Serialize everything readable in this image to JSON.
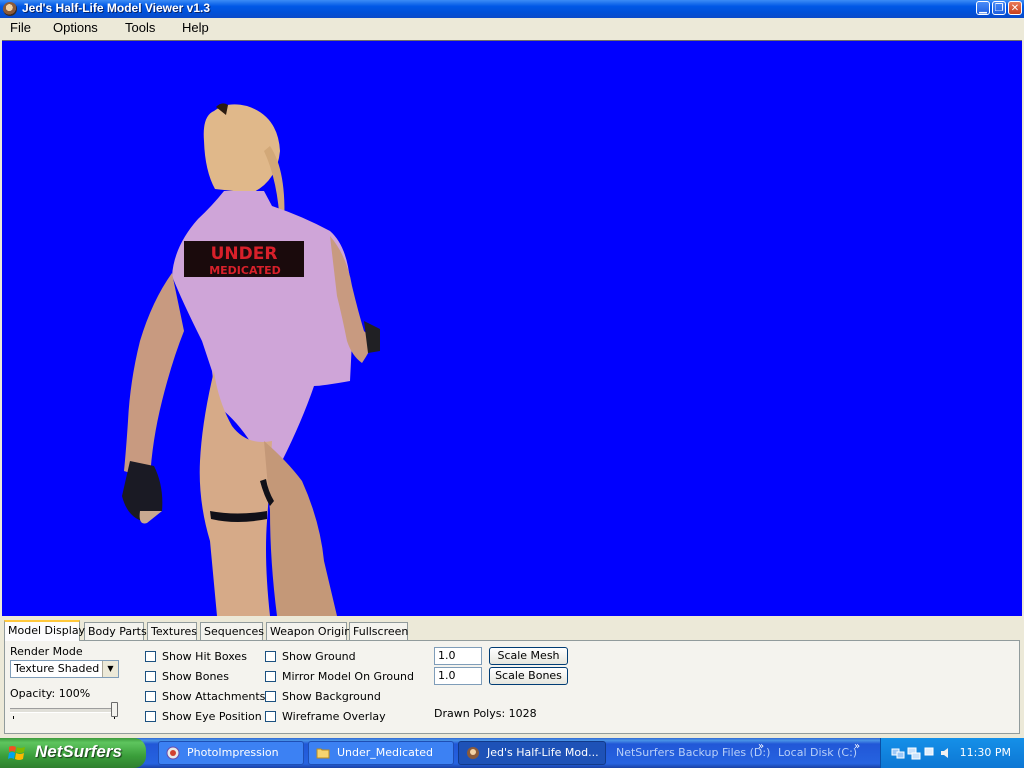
{
  "window": {
    "title": "Jed's Half-Life Model Viewer v1.3",
    "controls": [
      "minimize",
      "maximize",
      "close"
    ]
  },
  "menu": [
    "File",
    "Options",
    "Tools",
    "Help"
  ],
  "viewport": {
    "background": "#0000FF",
    "model_text_line1": "UNDER",
    "model_text_line2": "MEDICATED"
  },
  "tabs": [
    "Model Display",
    "Body Parts",
    "Textures",
    "Sequences",
    "Weapon Origin",
    "Fullscreen"
  ],
  "panel": {
    "render_mode_label": "Render Mode",
    "render_mode_value": "Texture Shaded",
    "opacity_label": "Opacity: 100%",
    "opacity_value": 1.0,
    "checkboxes_col1": [
      "Show Hit Boxes",
      "Show Bones",
      "Show Attachments",
      "Show Eye Position"
    ],
    "checkboxes_col2": [
      "Show Ground",
      "Mirror Model On Ground",
      "Show Background",
      "Wireframe Overlay"
    ],
    "scale_mesh_value": "1.0",
    "scale_bones_value": "1.0",
    "scale_mesh_label": "Scale Mesh",
    "scale_bones_label": "Scale Bones",
    "drawn_polys": "Drawn Polys: 1028"
  },
  "taskbar": {
    "start_label": "NetSurfers",
    "tasks": [
      "PhotoImpression",
      "Under_Medicated",
      "Jed's Half-Life Mod..."
    ],
    "links": [
      "NetSurfers Backup Files (D:)",
      "Local Disk (C:)"
    ],
    "chevrons": [
      "»",
      "»"
    ],
    "clock": "11:30 PM"
  },
  "colors": {
    "titlebar": "#0054E3",
    "viewport": "#0000FF",
    "taskbar": "#245EDC",
    "start": "#3C9A3C"
  }
}
